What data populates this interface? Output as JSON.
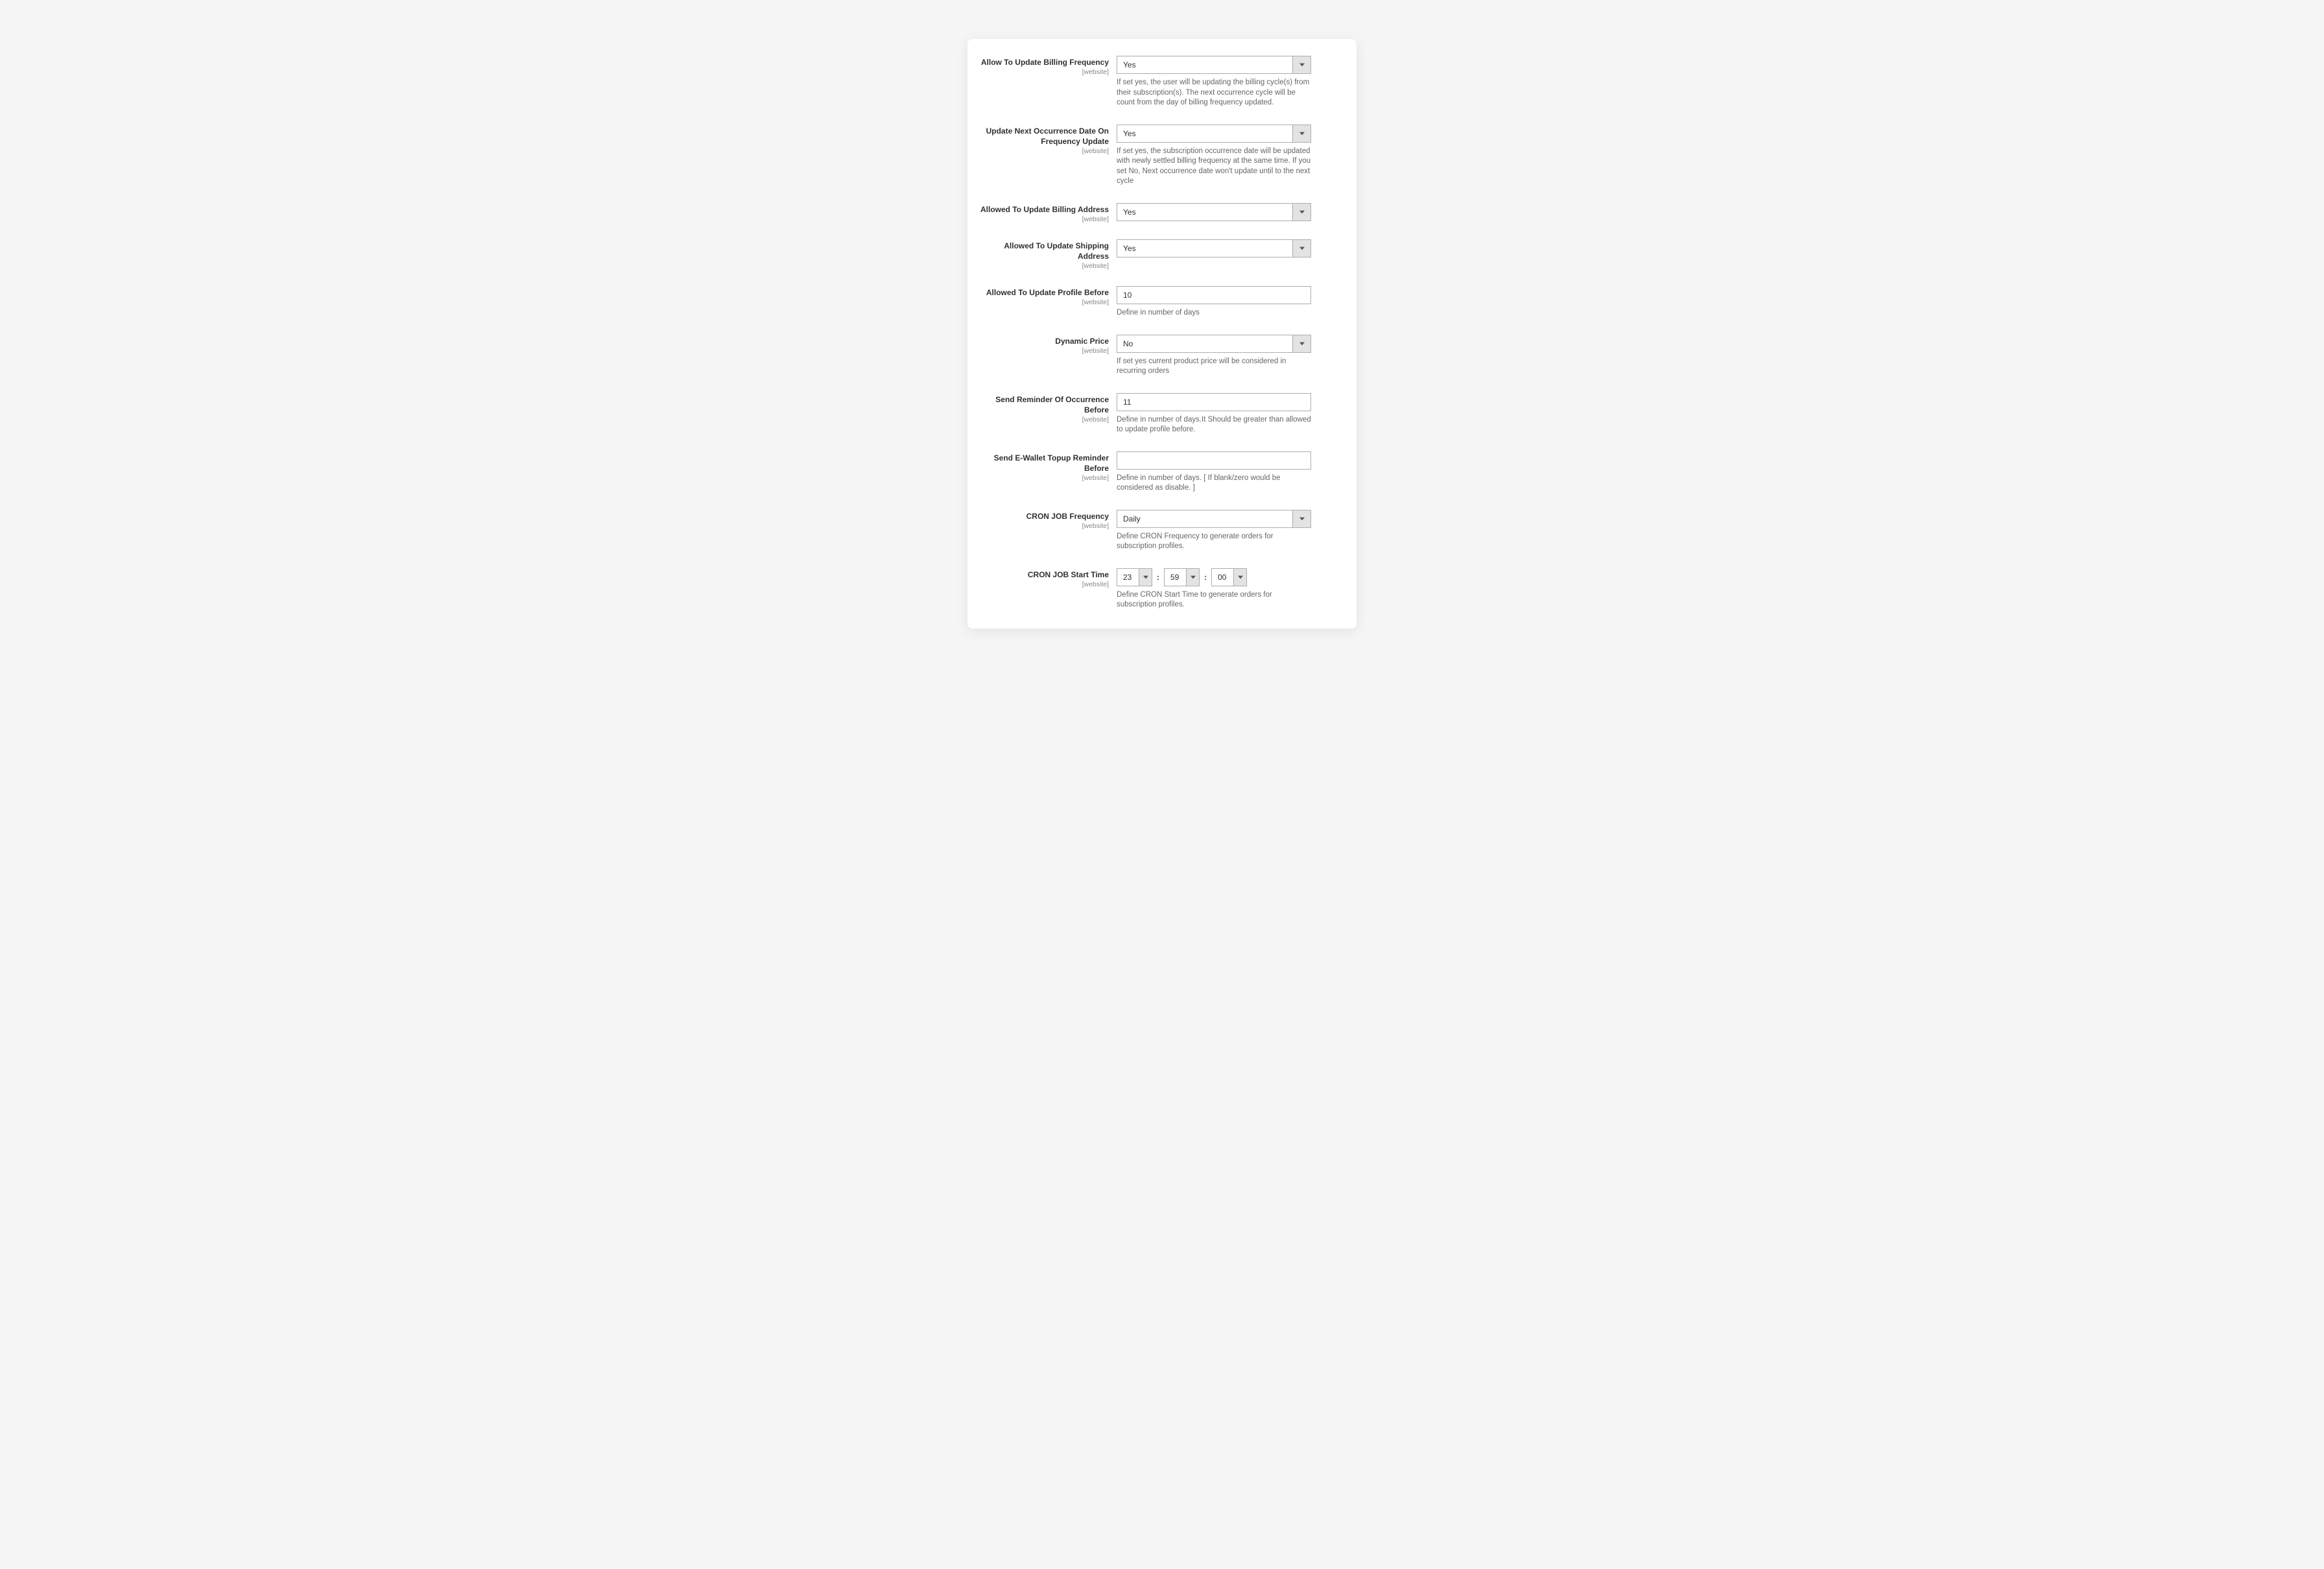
{
  "fields": {
    "allow_update_billing_frequency": {
      "label": "Allow To Update Billing Frequency",
      "scope": "[website]",
      "value": "Yes",
      "help": "If set yes, the user will be updating the billing cycle(s) from their subscription(s). The next occurrence cycle will be count from the day of billing frequency updated."
    },
    "update_next_occurrence": {
      "label": "Update Next Occurrence Date On Frequency Update",
      "scope": "[website]",
      "value": "Yes",
      "help": "If set yes, the subscription occurrence date will be updated with newly settled billing frequency at the same time. If you set No, Next occurrence date won't update until to the next cycle"
    },
    "allowed_update_billing_address": {
      "label": "Allowed To Update Billing Address",
      "scope": "[website]",
      "value": "Yes"
    },
    "allowed_update_shipping_address": {
      "label": "Allowed To Update Shipping Address",
      "scope": "[website]",
      "value": "Yes"
    },
    "allowed_update_profile_before": {
      "label": "Allowed To Update Profile Before",
      "scope": "[website]",
      "value": "10",
      "help": "Define in number of days"
    },
    "dynamic_price": {
      "label": "Dynamic Price",
      "scope": "[website]",
      "value": "No",
      "help": "If set yes current product price will be considered in recurring orders"
    },
    "send_reminder_occurrence": {
      "label": "Send Reminder Of Occurrence Before",
      "scope": "[website]",
      "value": "11",
      "help": "Define in number of days.It Should be greater than allowed to update profile before."
    },
    "send_ewallet_reminder": {
      "label": "Send E-Wallet Topup Reminder Before",
      "scope": "[website]",
      "value": "",
      "help": "Define in number of days. [ If blank/zero would be considered as disable. ]"
    },
    "cron_frequency": {
      "label": "CRON JOB Frequency",
      "scope": "[website]",
      "value": "Daily",
      "help": "Define CRON Frequency to generate orders for subscription profiles."
    },
    "cron_start_time": {
      "label": "CRON JOB Start Time",
      "scope": "[website]",
      "hour": "23",
      "minute": "59",
      "second": "00",
      "sep": ":",
      "help": "Define CRON Start Time to generate orders for subscription profiles."
    }
  }
}
